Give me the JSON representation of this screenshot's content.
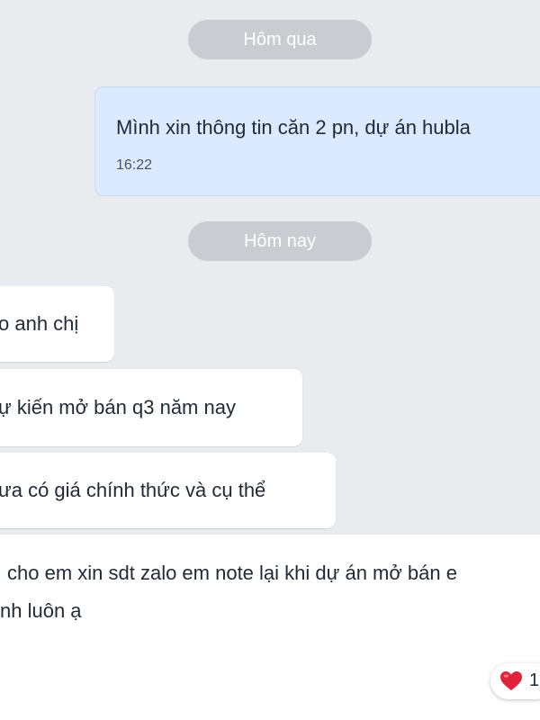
{
  "date_separators": {
    "yesterday": "Hôm qua",
    "today": "Hôm nay"
  },
  "sent_message": {
    "text": "Mình xin thông tin căn 2 pn, dự án hubla",
    "time": "16:22"
  },
  "received_messages": [
    {
      "text": "o anh chị"
    },
    {
      "text": "ự kiến mở bán q3 năm nay"
    },
    {
      "text": "ưa có giá chính thức và cụ thể"
    }
  ],
  "last_message": {
    "line1": "cho em xin sdt zalo em note lại khi dự án mở bán e",
    "line2": "nh luôn ạ"
  },
  "reaction": {
    "icon": "heart-icon",
    "color": "#e0233a",
    "count": "1"
  }
}
